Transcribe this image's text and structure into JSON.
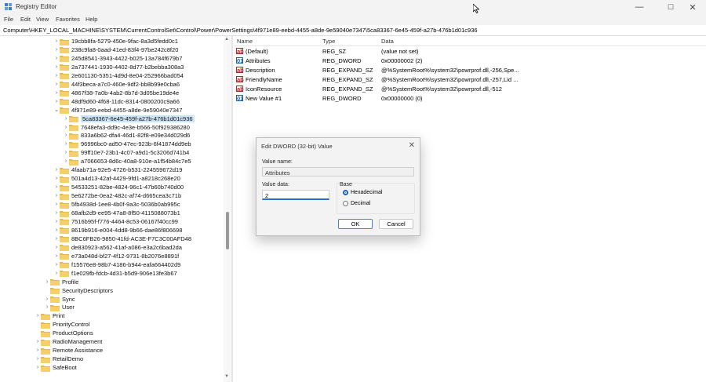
{
  "window": {
    "title": "Registry Editor",
    "controls": {
      "minimize": "—",
      "maximize": "☐",
      "close": "✕"
    }
  },
  "menu": [
    "File",
    "Edit",
    "View",
    "Favorites",
    "Help"
  ],
  "address": "Computer\\HKEY_LOCAL_MACHINE\\SYSTEM\\CurrentControlSet\\Control\\Power\\PowerSettings\\4f971e89-eebd-4455-a8de-9e59040e7347\\5ca83367-6e45-459f-a27b-476b1d01c936",
  "tree": {
    "items": [
      {
        "label": "19cbb8fa-5279-450e-9fac-8a3d5fedd0c1",
        "chevron": "›",
        "level": 1
      },
      {
        "label": "238c9fa8-0aad-41ed-83f4-97be242c8f20",
        "chevron": "›",
        "level": 1
      },
      {
        "label": "245d8541-3943-4422-b025-13a784f679b7",
        "chevron": "›",
        "level": 1
      },
      {
        "label": "2a737441-1930-4402-8d77-b2bebba308a3",
        "chevron": "›",
        "level": 1
      },
      {
        "label": "2e601130-5351-4d9d-8e04-252966bad054",
        "chevron": "›",
        "level": 1
      },
      {
        "label": "44f3beca-a7c0-460e-9df2-bb8b99e0cba6",
        "chevron": "›",
        "level": 1
      },
      {
        "label": "4867f38-7a0b-4ab2-8b7d-3d05be19de4e",
        "chevron": "›",
        "level": 1
      },
      {
        "label": "48df9d60-4f68-11dc-8314-0800200c9a66",
        "chevron": "›",
        "level": 1
      },
      {
        "label": "4f971e89-eebd-4455-a8de-9e59040e7347",
        "chevron": "⌄",
        "level": 1
      },
      {
        "label": "5ca83367-6e45-459f-a27b-476b1d01c936",
        "chevron": "›",
        "level": 2,
        "selected": true
      },
      {
        "label": "7648efa3-dd9c-4e3e-b566-50f929386280",
        "chevron": "›",
        "level": 2
      },
      {
        "label": "833a6b62-dfa4-46d1-82f8-e09e34d029d6",
        "chevron": "›",
        "level": 2
      },
      {
        "label": "96996bc0-ad50-47ec-923b-6f41874dd9eb",
        "chevron": "›",
        "level": 2
      },
      {
        "label": "99ff10e7-23b1-4c07-a9d1-5c3206d741b4",
        "chevron": "›",
        "level": 2
      },
      {
        "label": "a7066653-8d6c-40a8-910e-a1f54b84c7e5",
        "chevron": "›",
        "level": 2
      },
      {
        "label": "4faab71a-92e5-4726-b531-224559672d19",
        "chevron": "›",
        "level": 1
      },
      {
        "label": "501a4d13-42af-4429-9fd1-a8218c268e20",
        "chevron": "›",
        "level": 1
      },
      {
        "label": "54533251-82be-4824-96c1-47b60b740d00",
        "chevron": "›",
        "level": 1
      },
      {
        "label": "5e6272be-0ea2-482c-af74-d665cea3c71b",
        "chevron": "›",
        "level": 1
      },
      {
        "label": "5fb4938d-1ee8-4b0f-9a3c-5036b0ab995c",
        "chevron": "›",
        "level": 1
      },
      {
        "label": "68afb2d9-ee95-47a8-8f50-4115088073b1",
        "chevron": "›",
        "level": 1
      },
      {
        "label": "7516b95f-f776-4464-8c53-06167f40cc99",
        "chevron": "›",
        "level": 1
      },
      {
        "label": "8619b916-e004-4dd8-9b66-dae86f806698",
        "chevron": "›",
        "level": 1
      },
      {
        "label": "8BC6FB26-9850-41fd-AC3E-F7C3C00AFD48",
        "chevron": "›",
        "level": 1
      },
      {
        "label": "de830923-a562-41af-a086-e3a2c6bad2da",
        "chevron": "›",
        "level": 1
      },
      {
        "label": "e73a048d-bf27-4f12-9731-8b2076e8891f",
        "chevron": "›",
        "level": 1
      },
      {
        "label": "f15576e8-98b7-4186-b944-eafa664402d9",
        "chevron": "›",
        "level": 1
      },
      {
        "label": "f1e029fb-fdcb-4d31-b5d9-906e13fe3b67",
        "chevron": "›",
        "level": 1
      },
      {
        "label": "Profile",
        "chevron": "›",
        "level": 0
      },
      {
        "label": "SecurityDescriptors",
        "chevron": "",
        "level": 0
      },
      {
        "label": "Sync",
        "chevron": "›",
        "level": 0
      },
      {
        "label": "User",
        "chevron": "›",
        "level": 0
      },
      {
        "label": "Print",
        "chevron": "›",
        "level": -1
      },
      {
        "label": "PriorityControl",
        "chevron": "",
        "level": -1
      },
      {
        "label": "ProductOptions",
        "chevron": "",
        "level": -1
      },
      {
        "label": "RadioManagement",
        "chevron": "›",
        "level": -1
      },
      {
        "label": "Remote Assistance",
        "chevron": "›",
        "level": -1
      },
      {
        "label": "RetailDemo",
        "chevron": "›",
        "level": -1
      },
      {
        "label": "SafeBoot",
        "chevron": "›",
        "level": -1
      }
    ]
  },
  "list": {
    "columns": [
      "Name",
      "Type",
      "Data"
    ],
    "rows": [
      {
        "icon": "ab",
        "name": "(Default)",
        "type": "REG_SZ",
        "data": "(value not set)"
      },
      {
        "icon": "dw",
        "name": "Attributes",
        "type": "REG_DWORD",
        "data": "0x00000002 (2)"
      },
      {
        "icon": "ab",
        "name": "Description",
        "type": "REG_EXPAND_SZ",
        "data": "@%SystemRoot%\\system32\\powrprof.dll,-256,Spe..."
      },
      {
        "icon": "ab",
        "name": "FriendlyName",
        "type": "REG_EXPAND_SZ",
        "data": "@%SystemRoot%\\system32\\powrprof.dll,-257,Lid ..."
      },
      {
        "icon": "ab",
        "name": "IconResource",
        "type": "REG_EXPAND_SZ",
        "data": "@%SystemRoot%\\system32\\powrprof.dll,-512"
      },
      {
        "icon": "dw",
        "name": "New Value #1",
        "type": "REG_DWORD",
        "data": "0x00000000 (0)"
      }
    ]
  },
  "dialog": {
    "title": "Edit DWORD (32-bit) Value",
    "close": "✕",
    "value_name_label": "Value name:",
    "value_name": "Attributes",
    "value_data_label": "Value data:",
    "value_data": "2",
    "base_label": "Base",
    "base_options": [
      "Hexadecimal",
      "Decimal"
    ],
    "base_selected": "Hexadecimal",
    "ok": "OK",
    "cancel": "Cancel"
  },
  "colors": {
    "folder": "#e9b949",
    "selection": "#cce4f7",
    "accent": "#1f5fbf"
  }
}
